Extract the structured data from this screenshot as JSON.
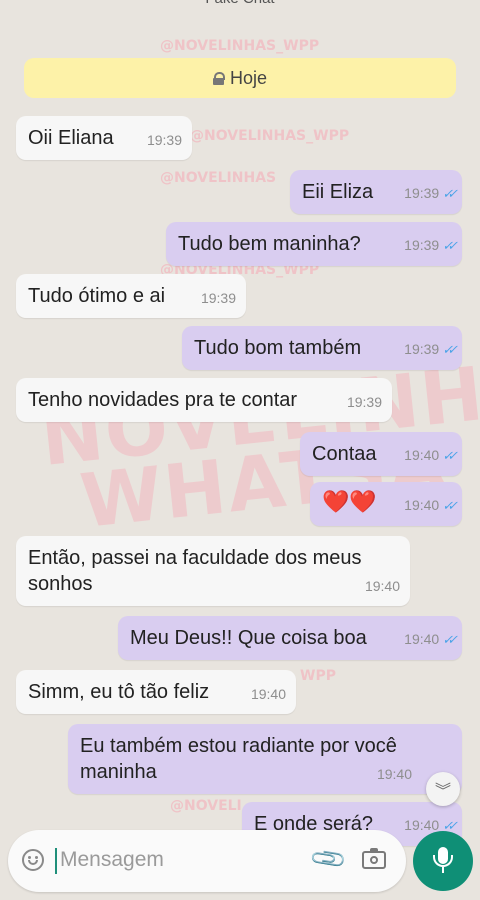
{
  "header": {
    "title": "Fake Chat"
  },
  "date_label": "Hoje",
  "watermarks": {
    "handle_1": "@NOVELINHAS_WPP",
    "handle_2": "@NOVELINHAS_WPP",
    "handle_3": "@NOVELINHAS",
    "handle_4": "@NOVELINHAS_WPP",
    "big_1": "NOVELINHAS",
    "big_2": "WHATSA",
    "handle_5": "WPP",
    "handle_6": "@NOVELI"
  },
  "messages": [
    {
      "dir": "in",
      "text": "Oii Eliana",
      "time": "19:39"
    },
    {
      "dir": "out",
      "text": "Eii Eliza",
      "time": "19:39"
    },
    {
      "dir": "out",
      "text": "Tudo bem maninha?",
      "time": "19:39"
    },
    {
      "dir": "in",
      "text": "Tudo ótimo e ai",
      "time": "19:39"
    },
    {
      "dir": "out",
      "text": "Tudo bom também",
      "time": "19:39"
    },
    {
      "dir": "in",
      "text": "Tenho novidades pra te contar",
      "time": "19:39"
    },
    {
      "dir": "out",
      "text": "Contaa",
      "time": "19:40"
    },
    {
      "dir": "out",
      "text": "❤️❤️",
      "time": "19:40"
    },
    {
      "dir": "in",
      "text": "Então, passei na faculdade dos meus sonhos",
      "time": "19:40"
    },
    {
      "dir": "out",
      "text": "Meu Deus!! Que coisa boa",
      "time": "19:40"
    },
    {
      "dir": "in",
      "text": "Simm, eu tô tão feliz",
      "time": "19:40"
    },
    {
      "dir": "out",
      "text": "Eu também estou radiante por você maninha",
      "time": "19:40"
    },
    {
      "dir": "out",
      "text": "E onde será?",
      "time": "19:40"
    }
  ],
  "input": {
    "placeholder": "Mensagem"
  },
  "colors": {
    "incoming_bubble": "#f7f7f7",
    "outgoing_bubble": "#d9cdf0",
    "read_ticks": "#4aa3e8",
    "mic_button": "#0f8f76",
    "date_pill": "#fdf2a8"
  },
  "icons": {
    "lock": "lock-icon",
    "read_receipt": "double-check-icon",
    "scroll_down": "chevron-double-down-icon",
    "emoji": "emoji-icon",
    "attach": "paperclip-icon",
    "camera": "camera-icon",
    "mic": "microphone-icon"
  }
}
